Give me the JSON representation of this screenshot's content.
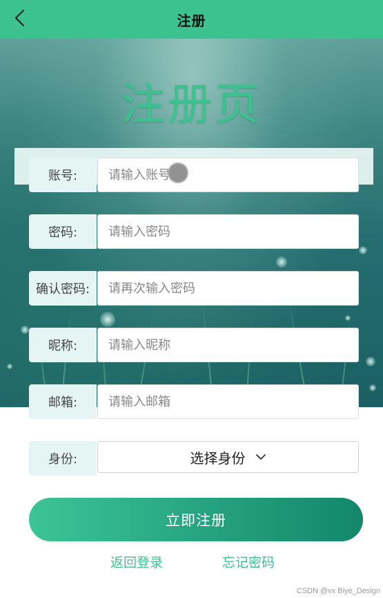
{
  "header": {
    "title": "注册",
    "back_icon": "chevron-left-icon",
    "bg_color": "#3cc28f"
  },
  "hero": {
    "title": "注册页",
    "title_color": "#3cc28f"
  },
  "form": {
    "account": {
      "label": "账号:",
      "placeholder": "请输入账号"
    },
    "password": {
      "label": "密码:",
      "placeholder": "请输入密码"
    },
    "confirm_password": {
      "label": "确认密码:",
      "placeholder": "请再次输入密码"
    },
    "nickname": {
      "label": "昵称:",
      "placeholder": "请输入昵称"
    },
    "email": {
      "label": "邮箱:",
      "placeholder": "请输入邮箱"
    },
    "role": {
      "label": "身份:",
      "selected": "选择身份",
      "icon": "chevron-down-icon"
    }
  },
  "actions": {
    "submit_label": "立即注册",
    "back_login_label": "返回登录",
    "forgot_password_label": "忘记密码"
  },
  "watermark": "CSDN @vx Biye_Design"
}
